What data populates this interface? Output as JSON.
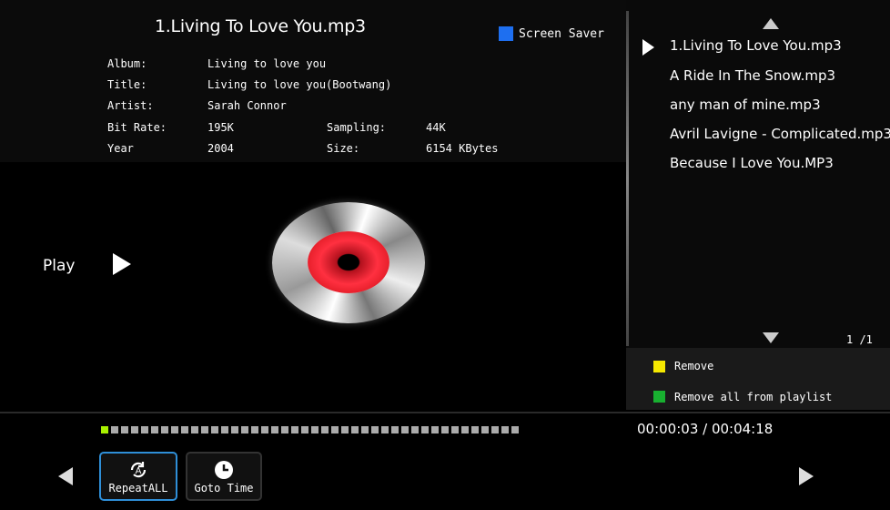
{
  "now_playing": {
    "title": "1.Living To Love You.mp3",
    "screen_saver_label": "Screen Saver",
    "screen_saver_color": "#1e6ff0",
    "album_label": "Album:",
    "album": "Living to love you",
    "title_label": "Title:",
    "song_title": "Living to love you(Bootwang)",
    "artist_label": "Artist:",
    "artist": "Sarah Connor",
    "bitrate_label": "Bit Rate:",
    "bitrate": "195K",
    "sampling_label": "Sampling:",
    "sampling": "44K",
    "year_label": "Year",
    "year": "2004",
    "size_label": "Size:",
    "size": "6154 KBytes",
    "status": "Play"
  },
  "playlist": {
    "items": [
      "1.Living To Love You.mp3",
      "A Ride In The Snow.mp3",
      "any man of mine.mp3",
      "Avril Lavigne - Complicated.mp3",
      "Because I Love You.MP3"
    ],
    "selected_index": 0,
    "page": "1 /1"
  },
  "color_keys": {
    "remove_label": "Remove",
    "remove_color": "#f5e800",
    "remove_all_label": "Remove all from playlist",
    "remove_all_color": "#18b030"
  },
  "playback": {
    "elapsed": "00:00:03",
    "total": "00:04:18",
    "time_display": "00:00:03 / 00:04:18",
    "progress_fraction": 0.012,
    "segments_total": 42
  },
  "buttons": {
    "repeat_label": "RepeatALL",
    "goto_label": "Goto Time"
  },
  "icons": {
    "repeat": "repeat-a-icon",
    "goto": "clock-icon"
  }
}
